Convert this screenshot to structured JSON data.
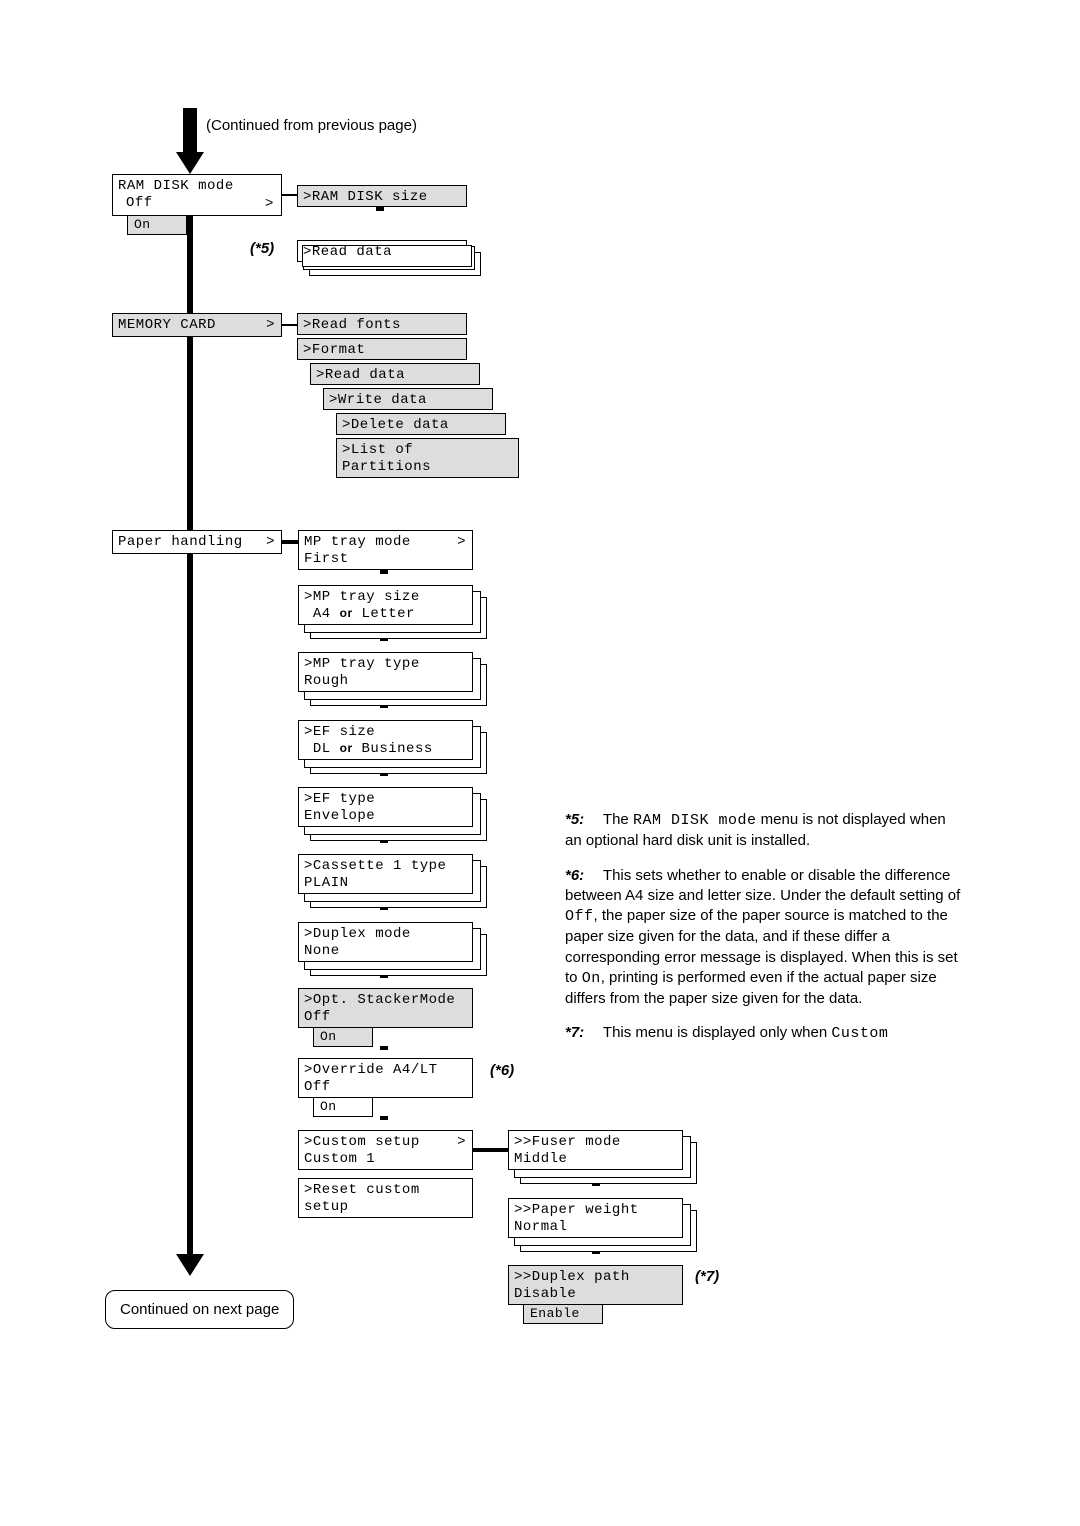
{
  "header": {
    "continued_from": "(Continued from previous page)"
  },
  "ram_disk": {
    "title": "RAM DISK mode",
    "value": "Off",
    "option_on": "On",
    "child1": ">RAM DISK size",
    "child2": ">Read data",
    "ref5": "(*5)"
  },
  "memory_card": {
    "title": "MEMORY CARD",
    "child_readfonts": ">Read fonts",
    "child_format": ">Format",
    "child_readdata": ">Read data",
    "child_writedata": ">Write data",
    "child_deletedata": ">Delete data",
    "child_listpart_l1": ">List of",
    "child_listpart_l2": " Partitions"
  },
  "paper": {
    "title": "Paper handling",
    "mp_mode_l1": "MP tray mode",
    "mp_mode_l2": " First",
    "mp_size_l1": ">MP tray size",
    "mp_size_l2a": "A4",
    "mp_size_or": "or",
    "mp_size_l2b": "Letter",
    "mp_type_l1": ">MP tray type",
    "mp_type_l2": " Rough",
    "ef_size_l1": ">EF size",
    "ef_size_l2a": "DL",
    "ef_size_or": "or",
    "ef_size_l2b": "Business",
    "ef_type_l1": ">EF type",
    "ef_type_l2": " Envelope",
    "cas_l1": ">Cassette 1 type",
    "cas_l2": " PLAIN",
    "dup_l1": ">Duplex mode",
    "dup_l2": " None",
    "stacker_l1": ">Opt. StackerMode",
    "stacker_l2": " Off",
    "stacker_on": "On",
    "override_l1": ">Override A4/LT",
    "override_l2": " Off",
    "override_on": "On",
    "ref6": "(*6)",
    "custom_l1": ">Custom setup",
    "custom_l2": " Custom 1",
    "reset_l1": ">Reset custom",
    "reset_l2": "setup"
  },
  "custom_children": {
    "fuser_l1": ">>Fuser mode",
    "fuser_l2": " Middle",
    "weight_l1": ">>Paper weight",
    "weight_l2": " Normal",
    "duplex_l1": ">>Duplex path",
    "duplex_l2": " Disable",
    "duplex_en": "Enable",
    "ref7": "(*7)"
  },
  "footer": {
    "continued_next": "Continued on next page"
  },
  "notes": {
    "n5_pre": "The",
    "n5_code": "RAM DISK mode",
    "n5_post": " menu is not displayed when an optional hard disk unit is installed.",
    "n6_a": "This sets whether to enable or disable the difference between A4 size and letter size. Under the default setting of ",
    "n6_off": "Off",
    "n6_b": ", the paper size of the paper source is matched to the paper size given for the data, and if these differ a corresponding error message is displayed. When this is set to ",
    "n6_on": "On",
    "n6_c": ", printing is performed even if the actual paper size differs from the paper size given for the data.",
    "n7_a": "This menu is displayed only when ",
    "n7_custom": "Custom"
  }
}
